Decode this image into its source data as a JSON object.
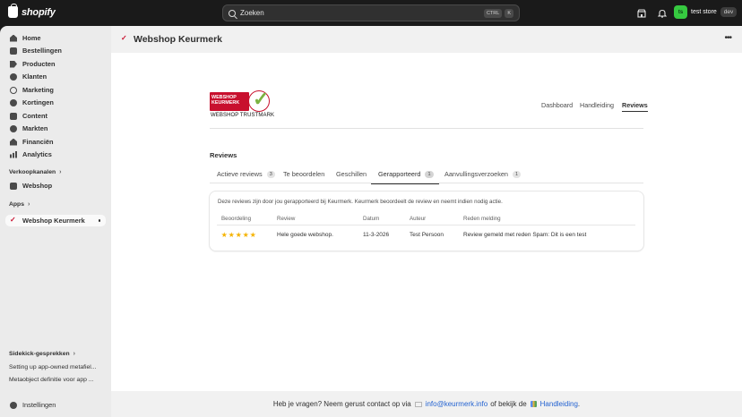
{
  "topbar": {
    "brand": "shopify",
    "search_placeholder": "Zoeken",
    "shortcut_key1": "CTRL",
    "shortcut_key2": "K",
    "store_name": "test store",
    "store_badge": "dev",
    "avatar_initials": "ts"
  },
  "sidebar": {
    "items": [
      {
        "label": "Home",
        "icon": "home-icon"
      },
      {
        "label": "Bestellingen",
        "icon": "inbox-icon"
      },
      {
        "label": "Producten",
        "icon": "tag-icon"
      },
      {
        "label": "Klanten",
        "icon": "person-icon"
      },
      {
        "label": "Marketing",
        "icon": "target-icon"
      },
      {
        "label": "Kortingen",
        "icon": "discount-icon"
      },
      {
        "label": "Content",
        "icon": "content-icon"
      },
      {
        "label": "Markten",
        "icon": "globe-icon"
      },
      {
        "label": "Financiën",
        "icon": "bank-icon"
      },
      {
        "label": "Analytics",
        "icon": "chart-icon"
      }
    ],
    "sales_channels_heading": "Verkoopkanalen",
    "webshop_label": "Webshop",
    "apps_heading": "Apps",
    "app_active_label": "Webshop Keurmerk",
    "sidekick_heading": "Sidekick-gesprekken",
    "sidekick_items": [
      "Setting up app-owned metafiel...",
      "Metaobject definitie voor app ..."
    ],
    "settings_label": "Instellingen"
  },
  "app": {
    "title": "Webshop Keurmerk",
    "brand_line1": "WEBSHOP",
    "brand_line2": "KEURMERK",
    "brand_trustmark": "WEBSHOP TRUSTMARK",
    "nav": [
      "Dashboard",
      "Handleiding",
      "Reviews"
    ],
    "section_title": "Reviews",
    "tabs": [
      {
        "label": "Actieve reviews",
        "count": "3"
      },
      {
        "label": "Te beoordelen",
        "count": ""
      },
      {
        "label": "Geschillen",
        "count": ""
      },
      {
        "label": "Gerapporteerd",
        "count": "1"
      },
      {
        "label": "Aanvullingsverzoeken",
        "count": "1"
      }
    ],
    "selected_tab": "Gerapporteerd",
    "intro": "Deze reviews zijn door jou gerapporteerd bij Keurmerk. Keurmerk beoordeelt de review en neemt indien nodig actie.",
    "table": {
      "headers": [
        "Beoordeling",
        "Review",
        "Datum",
        "Auteur",
        "Reden melding"
      ],
      "rows": [
        {
          "rating": 5,
          "review": "Hele goede webshop.",
          "date": "11-3-2026",
          "author": "Test Persoon",
          "reason": "Review gemeld met reden Spam: Dit is een test"
        }
      ]
    },
    "footer": {
      "text_before": "Heb je vragen? Neem gerust contact op via",
      "email": "info@keurmerk.info",
      "text_middle": "of bekijk de",
      "link": "Handleiding",
      "text_end": "."
    }
  },
  "colors": {
    "brand_red": "#c8102e",
    "check_green": "#7cb342",
    "star": "#f5b301",
    "link": "#2463d1"
  }
}
